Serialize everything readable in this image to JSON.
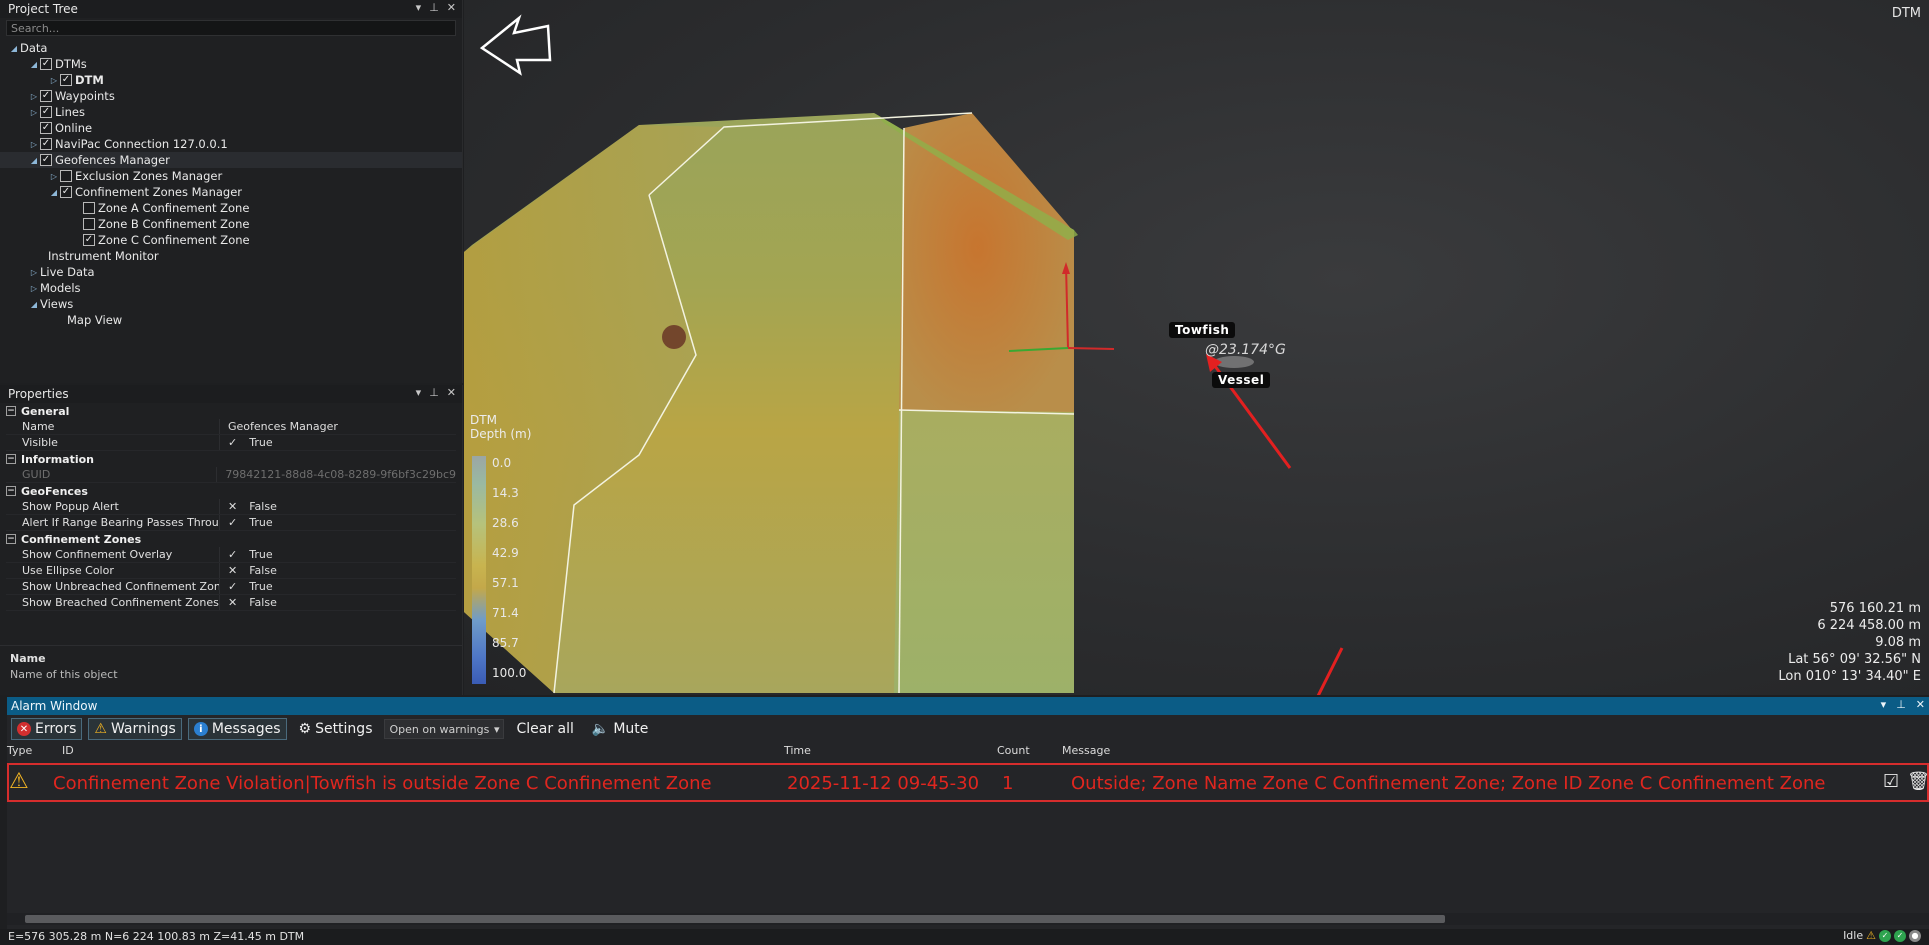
{
  "project_tree": {
    "title": "Project Tree",
    "search_placeholder": "Search...",
    "nodes": [
      {
        "label": "Data"
      },
      {
        "label": "DTMs"
      },
      {
        "label": "DTM"
      },
      {
        "label": "Waypoints"
      },
      {
        "label": "Lines"
      },
      {
        "label": "Online"
      },
      {
        "label": "NaviPac Connection 127.0.0.1"
      },
      {
        "label": "Geofences Manager"
      },
      {
        "label": "Exclusion Zones Manager"
      },
      {
        "label": "Confinement Zones Manager"
      },
      {
        "label": "Zone A Confinement Zone"
      },
      {
        "label": "Zone B Confinement Zone"
      },
      {
        "label": "Zone C Confinement Zone"
      },
      {
        "label": "Instrument Monitor"
      },
      {
        "label": "Live Data"
      },
      {
        "label": "Models"
      },
      {
        "label": "Views"
      },
      {
        "label": "Map View"
      }
    ]
  },
  "properties": {
    "title": "Properties",
    "categories": {
      "general": "General",
      "information": "Information",
      "geofences": "GeoFences",
      "confinement": "Confinement Zones"
    },
    "rows": [
      {
        "name": "Name",
        "value": "Geofences Manager"
      },
      {
        "name": "Visible",
        "value": "True"
      },
      {
        "name": "GUID",
        "value": "79842121-88d8-4c08-8289-9f6bf3c29bc9"
      },
      {
        "name": "Show Popup Alert",
        "value": "False"
      },
      {
        "name": "Alert If Range Bearing Passes Through E",
        "value": "True"
      },
      {
        "name": "Show Confinement Overlay",
        "value": "True"
      },
      {
        "name": "Use Ellipse Color",
        "value": "False"
      },
      {
        "name": "Show Unbreached Confinement Zones",
        "value": "True"
      },
      {
        "name": "Show Breached Confinement Zones in Se",
        "value": "False"
      }
    ],
    "desc_title": "Name",
    "desc_text": "Name of this object"
  },
  "map": {
    "view_label": "DTM",
    "legend_title": "DTM",
    "legend_subtitle": "Depth (m)",
    "legend_ticks": [
      "0.0",
      "14.3",
      "28.6",
      "42.9",
      "57.1",
      "71.4",
      "85.7",
      "100.0"
    ],
    "towfish_label": "Towfish",
    "vessel_label": "Vessel",
    "heading_text": "@23.174°G",
    "coords": [
      "576 160.21 m",
      "6 224 458.00 m",
      "9.08 m",
      "Lat 56° 09' 32.56\" N",
      "Lon 010° 13' 34.40\" E"
    ]
  },
  "alarm_window": {
    "title": "Alarm Window",
    "buttons": {
      "errors": "Errors",
      "warnings": "Warnings",
      "messages": "Messages",
      "settings": "Settings",
      "clear_all": "Clear all",
      "mute": "Mute"
    },
    "open_mode": "Open on warnings",
    "columns": {
      "type": "Type",
      "id": "ID",
      "time": "Time",
      "count": "Count",
      "message": "Message"
    },
    "alarm": {
      "id": "Confinement Zone Violation|Towfish is outside Zone C Confinement Zone",
      "time": "2025-11-12 09-45-30",
      "count": "1",
      "message": "Outside; Zone Name Zone C Confinement Zone; Zone ID Zone C Confinement Zone"
    },
    "alarm_color": "#e0261f"
  },
  "status_bar": {
    "position": "E=576 305.28 m N=6 224 100.83 m Z=41.45 m DTM",
    "state": "Idle"
  }
}
